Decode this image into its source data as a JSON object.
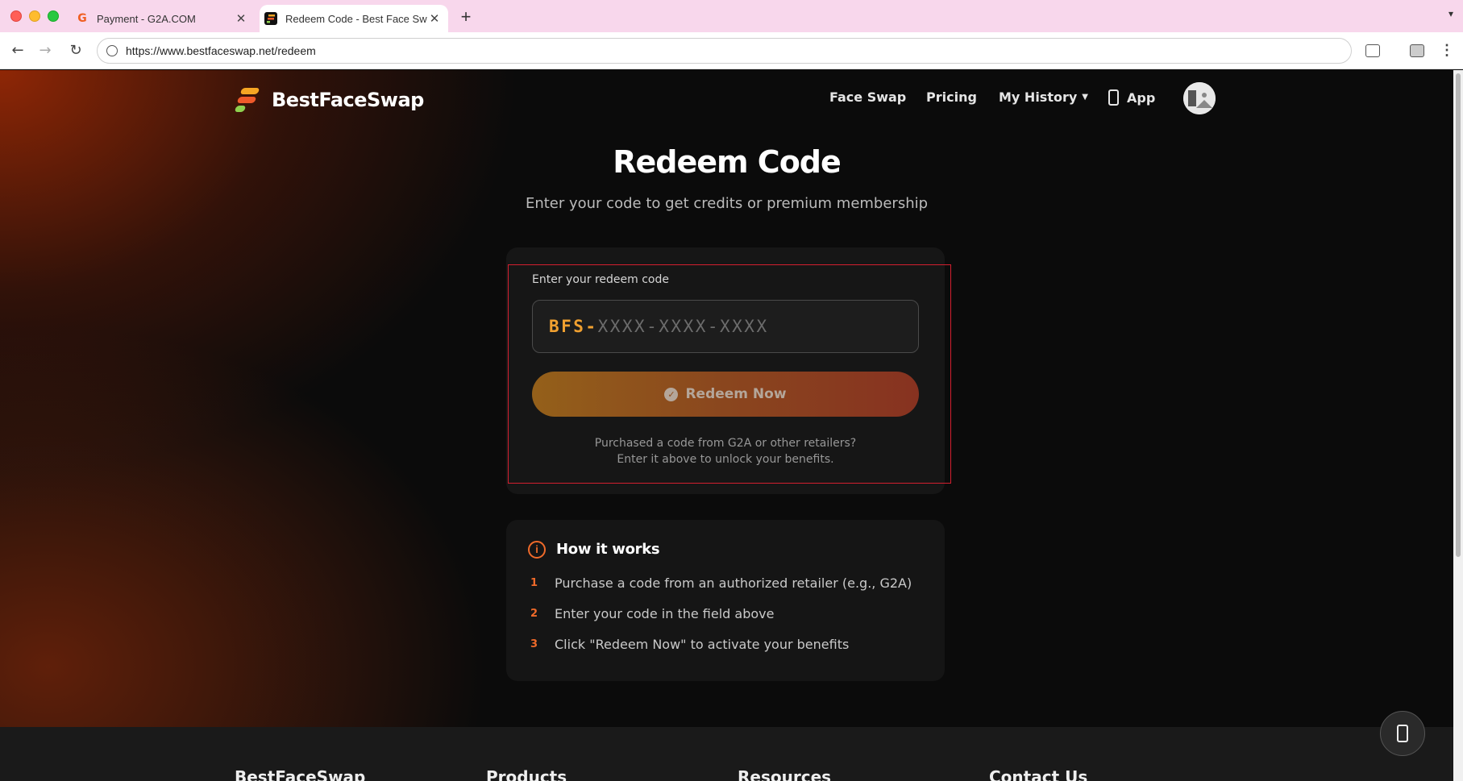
{
  "browser": {
    "tabs": [
      {
        "title": "Payment - G2A.COM",
        "favicon": "g2a-icon",
        "active": false
      },
      {
        "title": "Redeem Code - Best Face Swap",
        "favicon": "bestfaceswap-icon",
        "active": true
      }
    ],
    "url": "https://www.bestfaceswap.net/redeem"
  },
  "header": {
    "brand": "BestFaceSwap",
    "nav": {
      "face_swap": "Face Swap",
      "pricing": "Pricing",
      "my_history": "My History",
      "app": "App"
    }
  },
  "main": {
    "title": "Redeem Code",
    "subtitle": "Enter your code to get credits or premium membership",
    "form": {
      "label": "Enter your redeem code",
      "prefix": "BFS-",
      "placeholder": "XXXX-XXXX-XXXX",
      "button": "Redeem Now",
      "help_line_1": "Purchased a code from G2A or other retailers?",
      "help_line_2": "Enter it above to unlock your benefits."
    },
    "how_it_works": {
      "title": "How it works",
      "steps": [
        {
          "num": "1",
          "text": "Purchase a code from an authorized retailer (e.g., G2A)"
        },
        {
          "num": "2",
          "text": "Enter your code in the field above"
        },
        {
          "num": "3",
          "text": "Click \"Redeem Now\" to activate your benefits"
        }
      ]
    }
  },
  "footer": {
    "columns": [
      "BestFaceSwap",
      "Products",
      "Resources",
      "Contact Us"
    ]
  },
  "colors": {
    "accent_orange": "#ef6a2a",
    "code_prefix": "#f0a030",
    "highlight_outline": "#d31f2f"
  }
}
